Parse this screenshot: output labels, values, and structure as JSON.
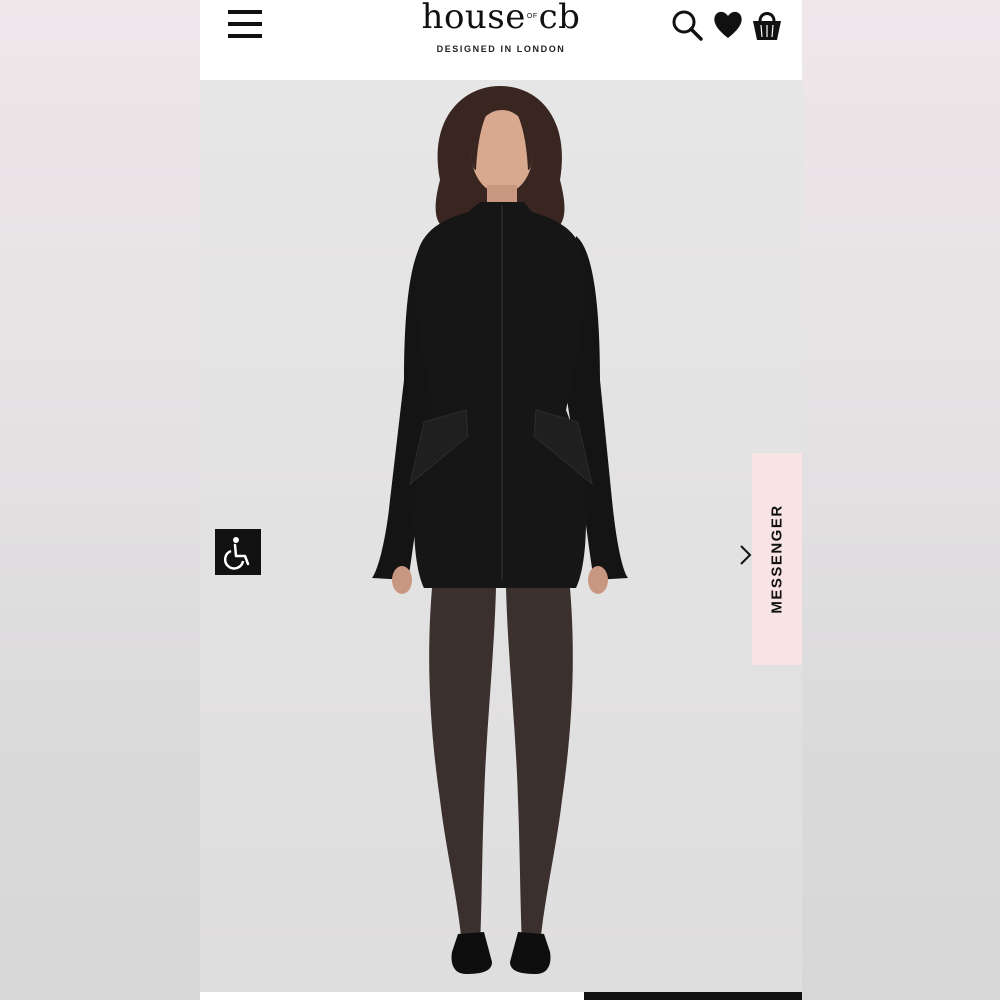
{
  "header": {
    "logo_main": "house",
    "logo_of": "OF",
    "logo_end": "cb",
    "tagline": "DESIGNED IN LONDON",
    "icons": [
      "menu-icon",
      "search-icon",
      "heart-icon",
      "shopping-bag-icon"
    ]
  },
  "product": {
    "image_alt": "Model wearing black long-sleeve mini dress with mock neck and hip flap pockets, sheer black tights and black heels"
  },
  "controls": {
    "accessibility_icon": "wheelchair-icon",
    "next_icon": "chevron-right-icon"
  },
  "messenger": {
    "label": "MESSENGER"
  },
  "colors": {
    "brand_text": "#111111",
    "messenger_bg": "#f8e3e5",
    "hero_bg": "#e4e3e3"
  }
}
